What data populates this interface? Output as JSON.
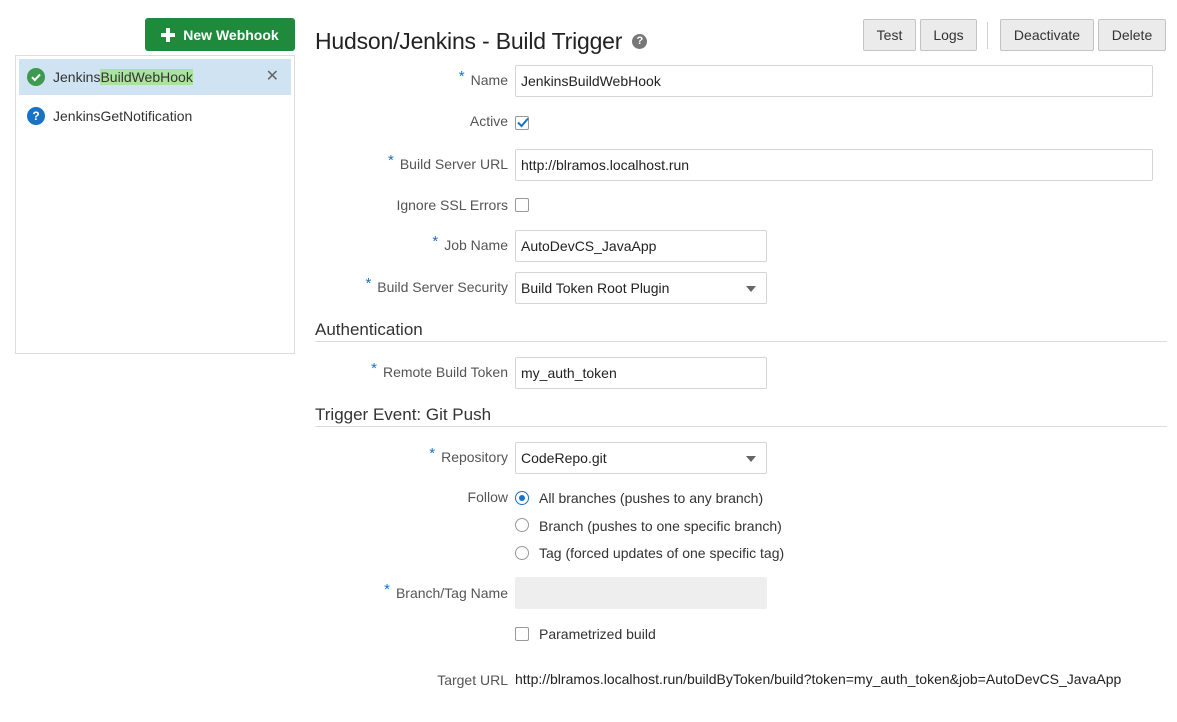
{
  "new_webhook_button": "New Webhook",
  "sidebar": {
    "items": [
      {
        "label_pre": "Jenkins",
        "label_highlight": "BuildWebHook",
        "status": "active",
        "selected": true
      },
      {
        "label": "JenkinsGetNotification",
        "status": "unknown"
      }
    ],
    "close_glyph": "✕",
    "unknown_glyph": "?"
  },
  "header": {
    "title": "Hudson/Jenkins - Build Trigger",
    "help_glyph": "?",
    "buttons": {
      "test": "Test",
      "logs": "Logs",
      "deactivate": "Deactivate",
      "delete": "Delete"
    }
  },
  "form": {
    "required_marker": "*",
    "name": {
      "label": "Name",
      "value": "JenkinsBuildWebHook"
    },
    "active": {
      "label": "Active",
      "checked": true
    },
    "build_server_url": {
      "label": "Build Server URL",
      "value": "http://blramos.localhost.run"
    },
    "ignore_ssl": {
      "label": "Ignore SSL Errors",
      "checked": false
    },
    "job_name": {
      "label": "Job Name",
      "value": "AutoDevCS_JavaApp"
    },
    "build_server_security": {
      "label": "Build Server Security",
      "value": "Build Token Root Plugin"
    }
  },
  "authentication": {
    "heading": "Authentication",
    "remote_build_token": {
      "label": "Remote Build Token",
      "value": "my_auth_token"
    }
  },
  "trigger": {
    "heading": "Trigger Event: Git Push",
    "repository": {
      "label": "Repository",
      "value": "CodeRepo.git"
    },
    "follow": {
      "label": "Follow",
      "options": [
        {
          "label": "All branches (pushes to any branch)",
          "checked": true
        },
        {
          "label": "Branch (pushes to one specific branch)",
          "checked": false
        },
        {
          "label": "Tag (forced updates of one specific tag)",
          "checked": false
        }
      ]
    },
    "branch_tag_name": {
      "label": "Branch/Tag Name",
      "value": ""
    },
    "parametrized_build": {
      "label": "Parametrized build",
      "checked": false
    }
  },
  "target_url": {
    "label": "Target URL",
    "value": "http://blramos.localhost.run/buildByToken/build?token=my_auth_token&job=AutoDevCS_JavaApp"
  },
  "colors": {
    "primary_green": "#1f8a3b",
    "accent_blue": "#1a72c6",
    "selection_bg": "#cfe3f2",
    "search_highlight": "#a9e39f"
  }
}
